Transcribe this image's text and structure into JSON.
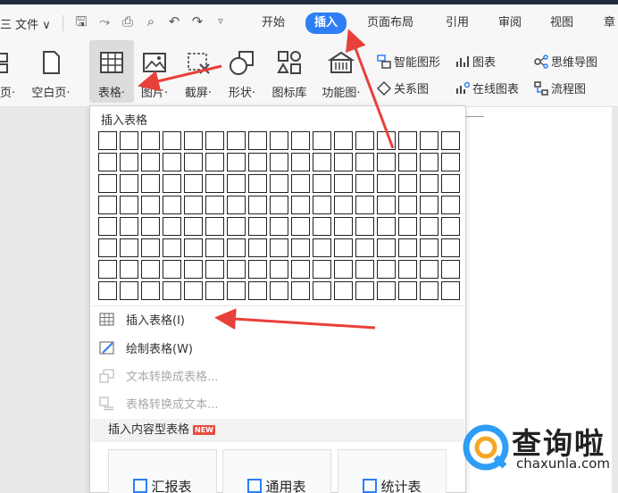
{
  "menubar": {
    "file_label": "三 文件 ∨",
    "tabs": [
      {
        "label": "开始",
        "active": false
      },
      {
        "label": "插入",
        "active": true
      },
      {
        "label": "页面布局",
        "active": false
      },
      {
        "label": "引用",
        "active": false
      },
      {
        "label": "审阅",
        "active": false
      },
      {
        "label": "视图",
        "active": false
      },
      {
        "label": "章",
        "active": false
      }
    ]
  },
  "ribbon": {
    "left_cut_label": "页·",
    "blank_page_label": "空白页·",
    "table_label": "表格·",
    "image_label": "图片·",
    "screenshot_label": "截屏·",
    "shape_label": "形状·",
    "icon_lib_label": "图标库",
    "func_chart_label": "功能图·",
    "smart_shape_label": "智能图形",
    "chart_label": "图表",
    "mindmap_label": "思维导图",
    "relation_label": "关系图",
    "online_chart_label": "在线图表",
    "flowchart_label": "流程图"
  },
  "dropdown": {
    "title": "插入表格",
    "grid_rows": 8,
    "grid_cols": 17,
    "insert_table": "插入表格(I)",
    "draw_table": "绘制表格(W)",
    "text_to_table": "文本转换成表格...",
    "table_to_text": "表格转换成文本...",
    "section_title": "插入内容型表格",
    "new_badge": "NEW",
    "cards": [
      "汇报表",
      "通用表",
      "统计表"
    ]
  },
  "watermark": {
    "name": "查询啦",
    "url": "chaxunla.com"
  },
  "colors": {
    "accent": "#2e7ef5",
    "arrow": "#e8403a",
    "badge": "#e74c3c"
  }
}
